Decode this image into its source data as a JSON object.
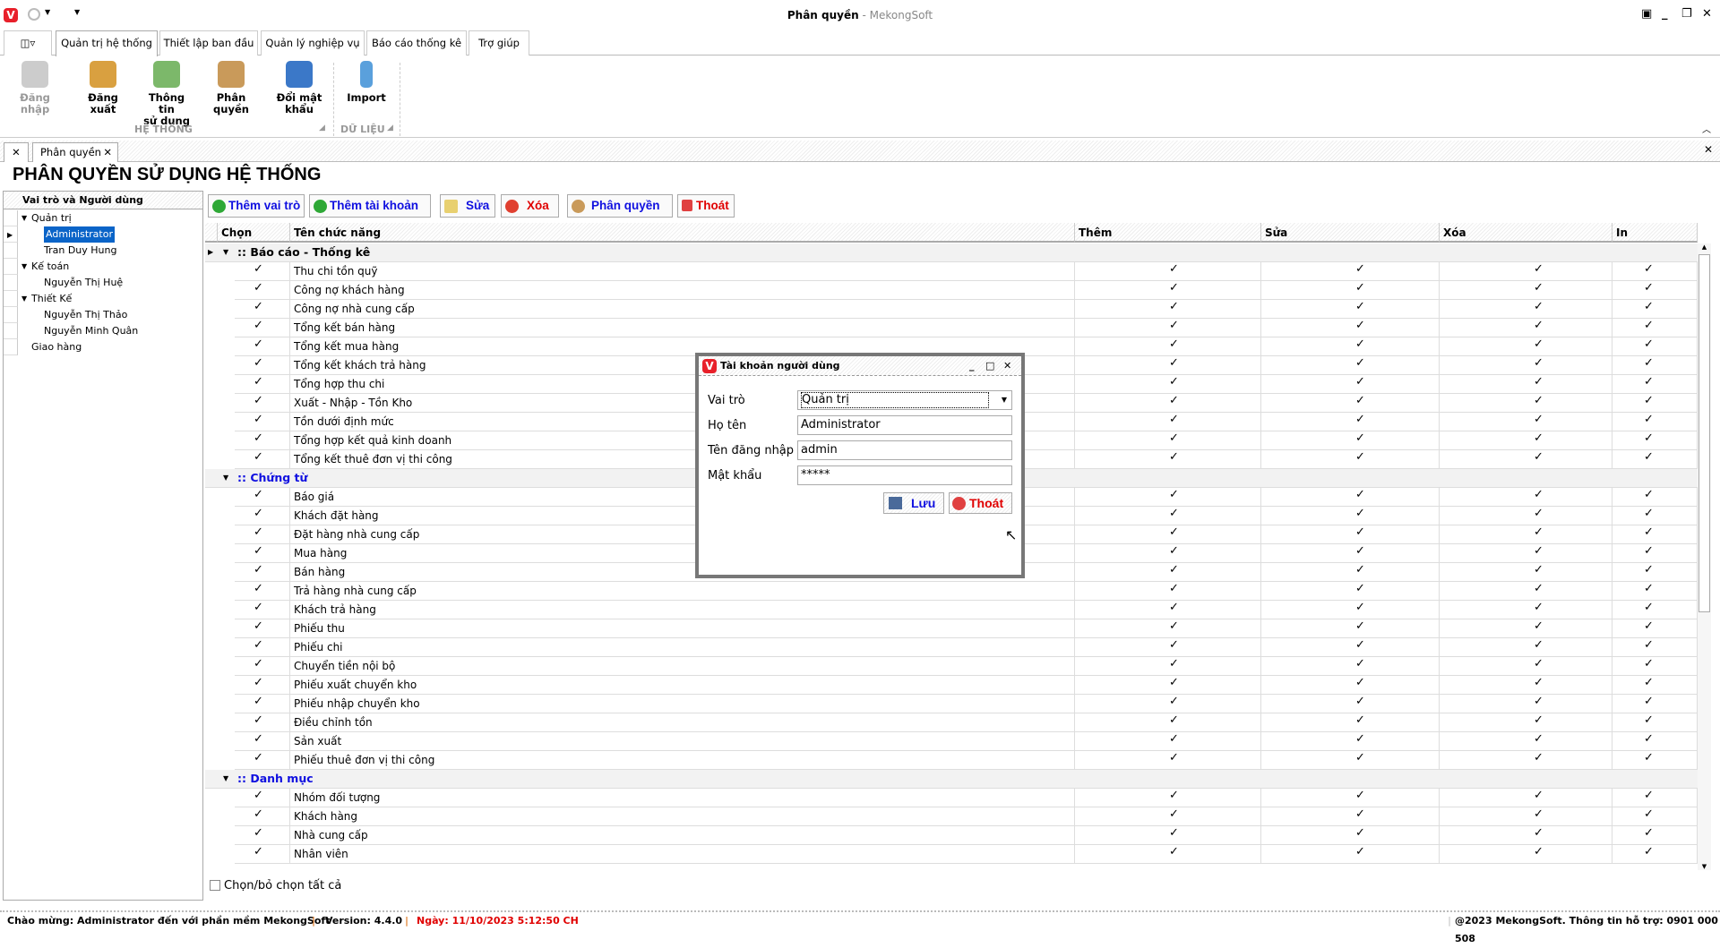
{
  "window": {
    "title": "Phân quyền",
    "app_name": "MekongSoft",
    "separator": " - "
  },
  "ribbon": {
    "tabs": [
      "Quản trị hệ thống",
      "Thiết lập ban đầu",
      "Quản lý nghiệp vụ",
      "Báo cáo thống kê",
      "Trợ giúp"
    ],
    "buttons": {
      "login": "Đăng nhập",
      "logout": "Đăng xuất",
      "info_1": "Thông tin",
      "info_2": "sử dụng",
      "permission": "Phân quyền",
      "password_1": "Đổi mật",
      "password_2": "khẩu",
      "import": "Import"
    },
    "groups": {
      "system": "HỆ THỐNG",
      "data": "DỮ LIỆU"
    }
  },
  "doc_tab": "Phân quyền",
  "page_title": "PHÂN QUYỀN SỬ DỤNG HỆ THỐNG",
  "left": {
    "header": "Vai trò và Người dùng",
    "tree": [
      {
        "label": "Quản trị",
        "level": 0,
        "expand": true
      },
      {
        "label": "Administrator",
        "level": 1,
        "selected": true
      },
      {
        "label": "Tran Duy Hung",
        "level": 1
      },
      {
        "label": "Kế toán",
        "level": 0,
        "expand": true
      },
      {
        "label": "Nguyễn Thị Huệ",
        "level": 1
      },
      {
        "label": "Thiết Kế",
        "level": 0,
        "expand": true
      },
      {
        "label": "Nguyễn Thị Thảo",
        "level": 1
      },
      {
        "label": "Nguyễn Minh Quân",
        "level": 1
      },
      {
        "label": "Giao hàng",
        "level": 0
      }
    ]
  },
  "toolbar": {
    "add_role": "Thêm vai trò",
    "add_account": "Thêm tài khoản",
    "edit": "Sửa",
    "delete": "Xóa",
    "permission": "Phân quyền",
    "exit": "Thoát"
  },
  "grid": {
    "columns": [
      "Chọn",
      "Tên chức năng",
      "Thêm",
      "Sửa",
      "Xóa",
      "In"
    ],
    "groups": [
      {
        "name": ":: Báo cáo - Thống kê",
        "items": [
          "Thu chi tồn quỹ",
          "Công nợ khách hàng",
          "Công nợ nhà cung cấp",
          "Tổng kết bán hàng",
          "Tổng kết mua hàng",
          "Tổng kết khách trả hàng",
          "Tổng hợp thu chi",
          "Xuất - Nhập - Tồn Kho",
          "Tồn dưới định mức",
          "Tổng hợp kết quả kinh doanh",
          "Tổng kết thuê đơn vị thi công"
        ]
      },
      {
        "name": ":: Chứng từ",
        "items": [
          "Báo giá",
          "Khách đặt hàng",
          "Đặt hàng nhà cung cấp",
          "Mua hàng",
          "Bán hàng",
          "Trả hàng nhà cung cấp",
          "Khách trả hàng",
          "Phiếu thu",
          "Phiếu chi",
          "Chuyển tiền nội bộ",
          "Phiếu xuất chuyển kho",
          "Phiếu nhập chuyển kho",
          "Điều chỉnh tồn",
          "Sản xuất",
          "Phiếu thuê đơn vị thi công"
        ]
      },
      {
        "name": ":: Danh mục",
        "items": [
          "Nhóm đối tượng",
          "Khách hàng",
          "Nhà cung cấp",
          "Nhân viên"
        ]
      }
    ],
    "check_mark": "✓",
    "select_all": "Chọn/bỏ chọn tất cả"
  },
  "dialog": {
    "title": "Tài khoản người dùng",
    "labels": {
      "role": "Vai trò",
      "name": "Họ tên",
      "username": "Tên đăng nhập",
      "password": "Mật khẩu"
    },
    "values": {
      "role": "Quản trị",
      "name": "Administrator",
      "username": "admin",
      "password": "*****"
    },
    "save": "Lưu",
    "exit": "Thoát"
  },
  "status": {
    "welcome": "Chào mừng: Administrator đến với phần mềm MekongSoft",
    "version": "Version: 4.4.0",
    "date": "Ngày: 11/10/2023 5:12:50 CH",
    "copyright": "@2023 MekongSoft. Thông tin hỗ trợ: 0901 000 508"
  },
  "colors": {
    "blue": "#1010e0",
    "red": "#e00000",
    "selection": "#0a64c8"
  }
}
